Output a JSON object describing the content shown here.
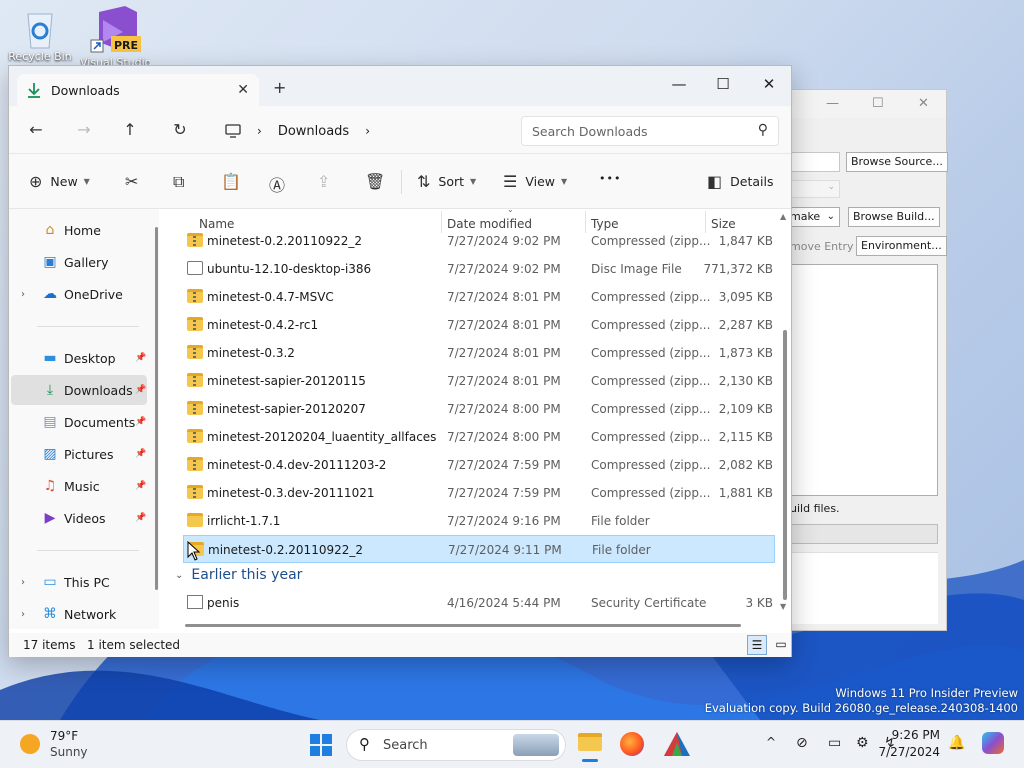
{
  "desktop": {
    "icons": [
      {
        "label": "Recycle Bin",
        "icon": "recycle-bin-icon"
      },
      {
        "label": "Visual Studio",
        "badge": "PRE",
        "icon": "visual-studio-icon"
      }
    ],
    "watermark_line1": "Windows 11 Pro Insider Preview",
    "watermark_line2": "Evaluation copy. Build 26080.ge_release.240308-1400"
  },
  "background_window": {
    "buttons": [
      "Browse Source...",
      "Browse Build...",
      "Environment..."
    ],
    "dropdown_value": "make",
    "remove_entry_label": "move Entry",
    "status_text": "uild files."
  },
  "explorer": {
    "tab_title": "Downloads",
    "search_placeholder": "Search Downloads",
    "breadcrumb": [
      "Downloads"
    ],
    "toolbar": {
      "new_label": "New",
      "sort_label": "Sort",
      "view_label": "View",
      "more_label": "•••",
      "details_label": "Details"
    },
    "nav": {
      "home": "Home",
      "gallery": "Gallery",
      "onedrive": "OneDrive",
      "desktop": "Desktop",
      "downloads": "Downloads",
      "documents": "Documents",
      "pictures": "Pictures",
      "music": "Music",
      "videos": "Videos",
      "this_pc": "This PC",
      "network": "Network"
    },
    "columns": {
      "name": "Name",
      "date": "Date modified",
      "type": "Type",
      "size": "Size"
    },
    "rows": [
      {
        "name": "minetest-0.2.20110922_2",
        "date": "7/27/2024 9:02 PM",
        "type": "Compressed (zipp...",
        "size": "1,847 KB",
        "icon": "zip"
      },
      {
        "name": "ubuntu-12.10-desktop-i386",
        "date": "7/27/2024 9:02 PM",
        "type": "Disc Image File",
        "size": "771,372 KB",
        "icon": "disc"
      },
      {
        "name": "minetest-0.4.7-MSVC",
        "date": "7/27/2024 8:01 PM",
        "type": "Compressed (zipp...",
        "size": "3,095 KB",
        "icon": "zip"
      },
      {
        "name": "minetest-0.4.2-rc1",
        "date": "7/27/2024 8:01 PM",
        "type": "Compressed (zipp...",
        "size": "2,287 KB",
        "icon": "zip"
      },
      {
        "name": "minetest-0.3.2",
        "date": "7/27/2024 8:01 PM",
        "type": "Compressed (zipp...",
        "size": "1,873 KB",
        "icon": "zip"
      },
      {
        "name": "minetest-sapier-20120115",
        "date": "7/27/2024 8:01 PM",
        "type": "Compressed (zipp...",
        "size": "2,130 KB",
        "icon": "zip"
      },
      {
        "name": "minetest-sapier-20120207",
        "date": "7/27/2024 8:00 PM",
        "type": "Compressed (zipp...",
        "size": "2,109 KB",
        "icon": "zip"
      },
      {
        "name": "minetest-20120204_luaentity_allfaces",
        "date": "7/27/2024 8:00 PM",
        "type": "Compressed (zipp...",
        "size": "2,115 KB",
        "icon": "zip"
      },
      {
        "name": "minetest-0.4.dev-20111203-2",
        "date": "7/27/2024 7:59 PM",
        "type": "Compressed (zipp...",
        "size": "2,082 KB",
        "icon": "zip"
      },
      {
        "name": "minetest-0.3.dev-20111021",
        "date": "7/27/2024 7:59 PM",
        "type": "Compressed (zipp...",
        "size": "1,881 KB",
        "icon": "zip"
      },
      {
        "name": "irrlicht-1.7.1",
        "date": "7/27/2024 9:16 PM",
        "type": "File folder",
        "size": "",
        "icon": "folder"
      },
      {
        "name": "minetest-0.2.20110922_2",
        "date": "7/27/2024 9:11 PM",
        "type": "File folder",
        "size": "",
        "icon": "folder",
        "selected": true
      }
    ],
    "group_label": "Earlier this year",
    "group_rows": [
      {
        "name": "penis",
        "date": "4/16/2024 5:44 PM",
        "type": "Security Certificate",
        "size": "3 KB",
        "icon": "cert"
      }
    ],
    "status": {
      "items": "17 items",
      "selected": "1 item selected"
    }
  },
  "taskbar": {
    "weather_temp": "79°F",
    "weather_text": "Sunny",
    "search_label": "Search",
    "time": "9:26 PM",
    "date": "7/27/2024"
  }
}
